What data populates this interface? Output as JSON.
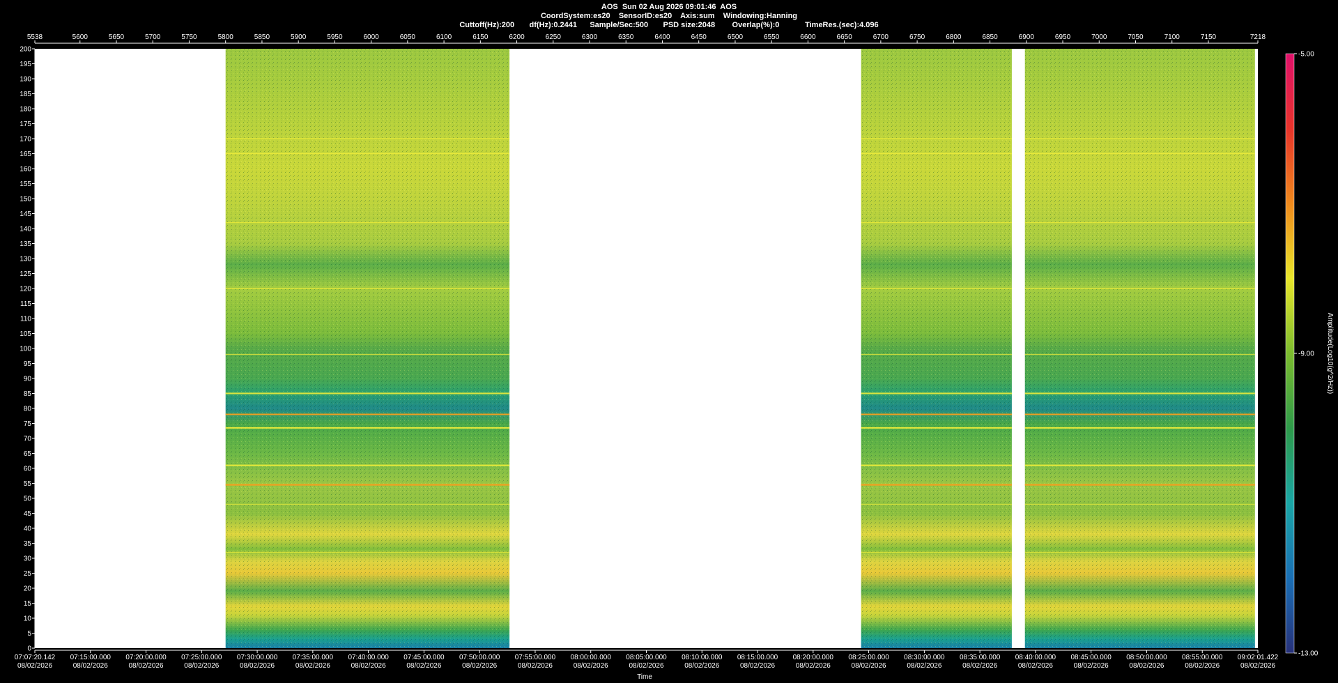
{
  "header": {
    "line1": "AOS  Sun 02 Aug 2026 09:01:46  AOS",
    "line2": "CoordSystem:es20    SensorID:es20    Axis:sum    Windowing:Hanning",
    "line3": "Cuttoff(Hz):200       df(Hz):0.2441      Sample/Sec:500       PSD size:2048        Overlap(%):0            TimeRes.(sec):4.096"
  },
  "chart_data": {
    "type": "heatmap",
    "xlabel": "Time",
    "ylabel": "",
    "top_axis": {
      "range": [
        5538,
        7218
      ],
      "ticks": [
        5538,
        5600,
        5650,
        5700,
        5750,
        5800,
        5850,
        5900,
        5950,
        6000,
        6050,
        6100,
        6150,
        6200,
        6250,
        6300,
        6350,
        6400,
        6450,
        6500,
        6550,
        6600,
        6650,
        6700,
        6750,
        6800,
        6850,
        6900,
        6950,
        7000,
        7050,
        7100,
        7150,
        7218
      ]
    },
    "y_axis": {
      "range": [
        0,
        200
      ],
      "ticks": [
        0,
        5,
        10,
        15,
        20,
        25,
        30,
        35,
        40,
        45,
        50,
        55,
        60,
        65,
        70,
        75,
        80,
        85,
        90,
        95,
        100,
        105,
        110,
        115,
        120,
        125,
        130,
        135,
        140,
        145,
        150,
        155,
        160,
        165,
        170,
        175,
        180,
        185,
        190,
        195,
        200
      ]
    },
    "time_ticks": [
      {
        "time": "07:07:20.142",
        "date": "08/02/2026"
      },
      {
        "time": "07:15:00.000",
        "date": "08/02/2026"
      },
      {
        "time": "07:20:00.000",
        "date": "08/02/2026"
      },
      {
        "time": "07:25:00.000",
        "date": "08/02/2026"
      },
      {
        "time": "07:30:00.000",
        "date": "08/02/2026"
      },
      {
        "time": "07:35:00.000",
        "date": "08/02/2026"
      },
      {
        "time": "07:40:00.000",
        "date": "08/02/2026"
      },
      {
        "time": "07:45:00.000",
        "date": "08/02/2026"
      },
      {
        "time": "07:50:00.000",
        "date": "08/02/2026"
      },
      {
        "time": "07:55:00.000",
        "date": "08/02/2026"
      },
      {
        "time": "08:00:00.000",
        "date": "08/02/2026"
      },
      {
        "time": "08:05:00.000",
        "date": "08/02/2026"
      },
      {
        "time": "08:10:00.000",
        "date": "08/02/2026"
      },
      {
        "time": "08:15:00.000",
        "date": "08/02/2026"
      },
      {
        "time": "08:20:00.000",
        "date": "08/02/2026"
      },
      {
        "time": "08:25:00.000",
        "date": "08/02/2026"
      },
      {
        "time": "08:30:00.000",
        "date": "08/02/2026"
      },
      {
        "time": "08:35:00.000",
        "date": "08/02/2026"
      },
      {
        "time": "08:40:00.000",
        "date": "08/02/2026"
      },
      {
        "time": "08:45:00.000",
        "date": "08/02/2026"
      },
      {
        "time": "08:50:00.000",
        "date": "08/02/2026"
      },
      {
        "time": "08:55:00.000",
        "date": "08/02/2026"
      },
      {
        "time": "09:02:01.422",
        "date": "08/02/2026"
      }
    ],
    "data_segments": [
      [
        5800,
        6190
      ],
      [
        6673,
        6880
      ],
      [
        6898,
        7214
      ]
    ],
    "spectral_lines_hz": [
      {
        "hz": 165,
        "strength": 0.7
      },
      {
        "hz": 170,
        "strength": 0.5
      },
      {
        "hz": 142,
        "strength": 0.6
      },
      {
        "hz": 120,
        "strength": 0.6
      },
      {
        "hz": 85,
        "strength": 0.75
      },
      {
        "hz": 78,
        "strength": 0.9
      },
      {
        "hz": 73.5,
        "strength": 0.8
      },
      {
        "hz": 61,
        "strength": 0.8
      },
      {
        "hz": 54.5,
        "strength": 0.95
      },
      {
        "hz": 98,
        "strength": 0.4
      },
      {
        "hz": 32,
        "strength": 0.4
      },
      {
        "hz": 48,
        "strength": 0.3
      }
    ],
    "colorbar": {
      "label": "Amplitude(Log10(g^2/Hz))",
      "range": [
        -13,
        -5
      ],
      "ticks": [
        {
          "value": -5,
          "label": "-5.00"
        },
        {
          "value": -9,
          "label": "-9.00"
        },
        {
          "value": -13,
          "label": "-13.00"
        }
      ],
      "colors": [
        "#27317a",
        "#1a6fb5",
        "#1aa6a6",
        "#2e9a4a",
        "#7cbc2e",
        "#e8e62a",
        "#f08a1c",
        "#e8332a",
        "#e0106a"
      ]
    }
  }
}
